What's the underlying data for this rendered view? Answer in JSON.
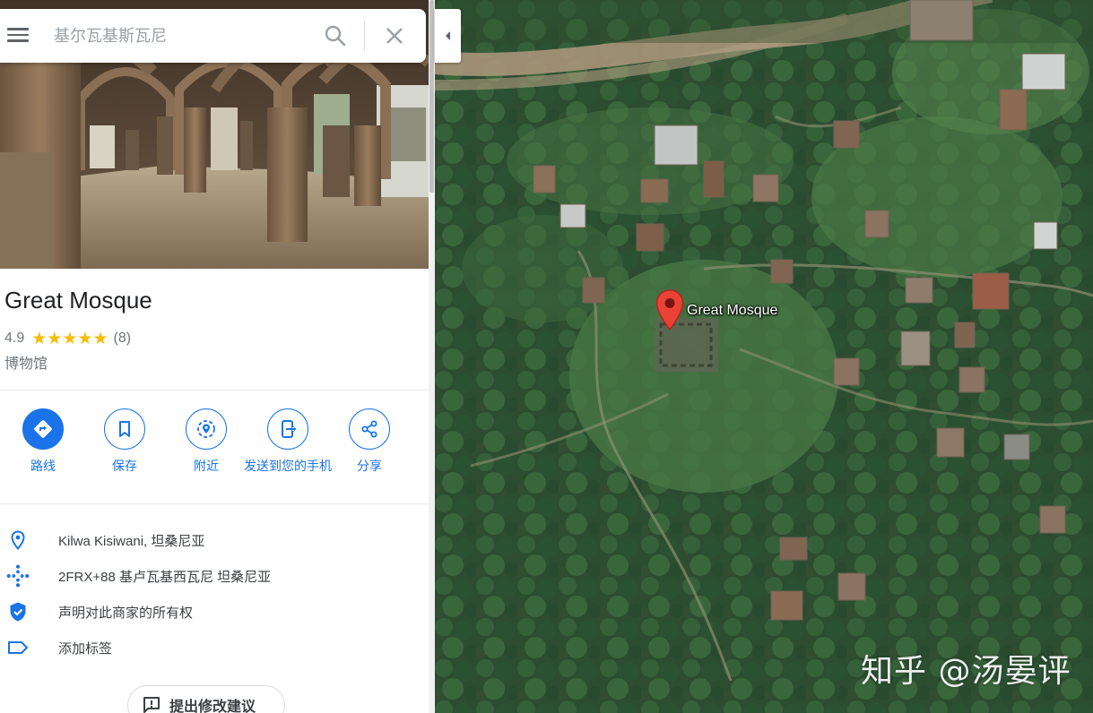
{
  "search": {
    "value": "",
    "placeholder": "基尔瓦基斯瓦尼"
  },
  "place": {
    "title": "Great Mosque",
    "rating": "4.9",
    "stars": 5,
    "review_count": "(8)",
    "category": "博物馆"
  },
  "actions": [
    {
      "label": "路线",
      "icon": "directions-icon"
    },
    {
      "label": "保存",
      "icon": "bookmark-icon"
    },
    {
      "label": "附近",
      "icon": "nearby-icon"
    },
    {
      "label": "发送到您的手机",
      "icon": "send-to-phone-icon"
    },
    {
      "label": "分享",
      "icon": "share-icon"
    }
  ],
  "info": {
    "address": "Kilwa Kisiwani, 坦桑尼亚",
    "plus_code": "2FRX+88 基卢瓦基西瓦尼 坦桑尼亚",
    "claim": "声明对此商家的所有权",
    "add_label": "添加标签"
  },
  "suggest_edit": "提出修改建议",
  "map": {
    "pin_label": "Great Mosque",
    "view": "satellite",
    "watermark": "知乎 @汤晏评"
  },
  "colors": {
    "accent": "#1a73e8",
    "star": "#fbbc04",
    "pin": "#ea4335"
  }
}
